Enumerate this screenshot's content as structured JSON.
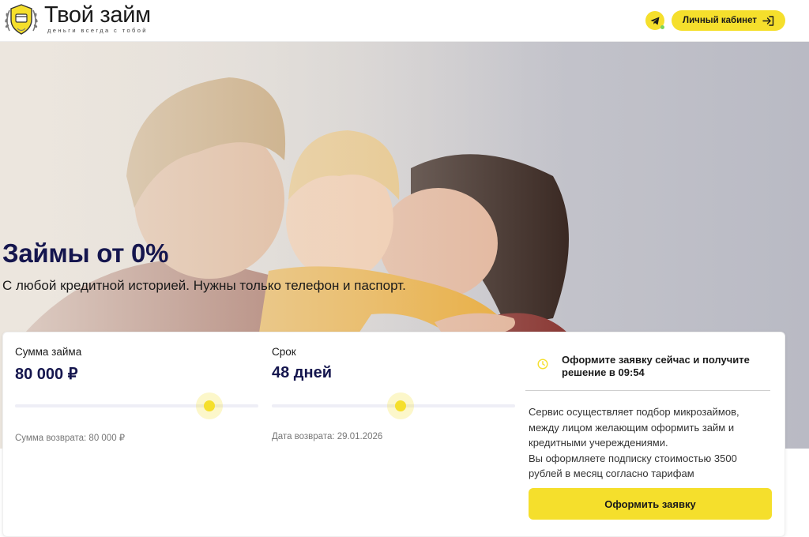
{
  "header": {
    "brand_title": "Твой займ",
    "brand_tagline": "деньги всегда с тобой",
    "telegram_icon": "telegram-icon",
    "cabinet_label": "Личный кабинет",
    "cabinet_icon": "login-arrow-icon"
  },
  "hero": {
    "title": "Займы от 0%",
    "subtitle": "С любой кредитной историей. Нужны только телефон и паспорт."
  },
  "calculator": {
    "amount": {
      "label": "Сумма займа",
      "value": "80 000 ₽",
      "slider_fraction": 0.8,
      "return_note": "Сумма возврата: 80 000 ₽"
    },
    "term": {
      "label": "Срок",
      "value": "48 дней",
      "slider_fraction": 0.53,
      "return_note": "Дата возврата: 29.01.2026"
    }
  },
  "info": {
    "clock_icon": "clock-icon",
    "headline": "Оформите заявку сейчас и получите решение в 09:54",
    "description_line1": "Сервис осуществляет подбор микрозаймов, между лицом желающим оформить займ и кредитными учереждениями.",
    "description_line2": "Вы оформляете подписку стоимостью 3500 рублей в месяц согласно тарифам",
    "apply_label": "Оформить заявку"
  },
  "colors": {
    "accent": "#f5df2c",
    "title_navy": "#15164e",
    "online_dot": "#7bd55e"
  }
}
